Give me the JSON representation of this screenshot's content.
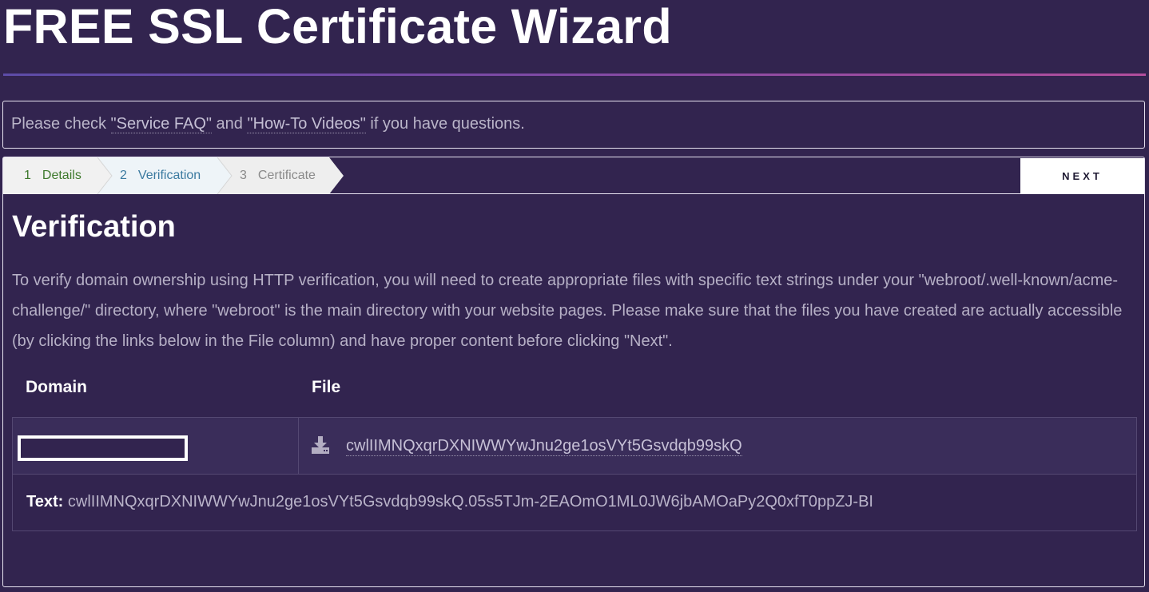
{
  "page": {
    "title": "FREE SSL Certificate Wizard"
  },
  "notice": {
    "prefix": "Please check ",
    "faq_link": "\"Service FAQ\"",
    "middle": " and ",
    "videos_link": "\"How-To Videos\"",
    "suffix": " if you have questions."
  },
  "steps": [
    {
      "num": "1",
      "label": "Details",
      "state": "done",
      "color": "#3f7a2e",
      "bg": "#f1f1f1"
    },
    {
      "num": "2",
      "label": "Verification",
      "state": "active",
      "color": "#3b7aa0",
      "bg": "#eef4f8"
    },
    {
      "num": "3",
      "label": "Certificate",
      "state": "pending",
      "color": "#8a8a8a",
      "bg": "#eeeeee"
    }
  ],
  "next_button": "NEXT",
  "section": {
    "title": "Verification",
    "intro": "To verify domain ownership using HTTP verification, you will need to create appropriate files with specific text strings under your \"webroot/.well-known/acme-challenge/\" directory, where \"webroot\" is the main directory with your website pages. Please make sure that the files you have created are actually accessible (by clicking the links below in the File column) and have proper content before clicking \"Next\"."
  },
  "table": {
    "headers": {
      "domain": "Domain",
      "file": "File"
    },
    "rows": [
      {
        "domain": "",
        "file_icon": "download-icon",
        "file_name": "cwlIIMNQxqrDXNIWWYwJnu2ge1osVYt5Gsvdqb99skQ",
        "text_label": "Text:",
        "text_value": "cwlIIMNQxqrDXNIWWYwJnu2ge1osVYt5Gsvdqb99skQ.05s5TJm-2EAOmO1ML0JW6jbAMOaPy2Q0xfT0ppZJ-BI"
      }
    ]
  },
  "colors": {
    "background": "#32244f",
    "rule_start": "#5d4ca8",
    "rule_end": "#b24e9d",
    "accent_white": "#ffffff"
  }
}
